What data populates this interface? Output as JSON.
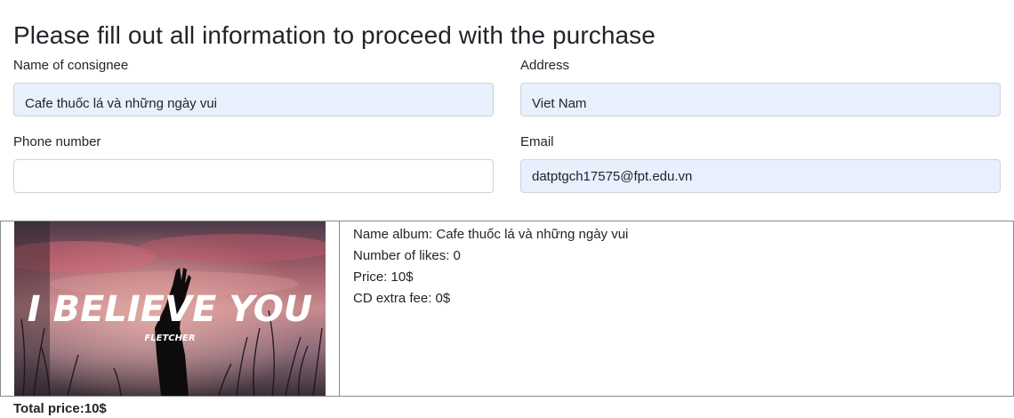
{
  "heading": "Please fill out all information to proceed with the purchase",
  "form": {
    "consignee": {
      "label": "Name of consignee",
      "value": "Cafe thuốc lá và những ngày vui"
    },
    "address": {
      "label": "Address",
      "value": "Viet Nam"
    },
    "phone": {
      "label": "Phone number",
      "value": ""
    },
    "email": {
      "label": "Email",
      "value": "datptgch17575@fpt.edu.vn"
    }
  },
  "album": {
    "cover_title": "I BELIEVE YOU",
    "cover_artist": "FLETCHER",
    "name_line": "Name album: Cafe thuốc lá và những ngày vui",
    "likes_line": "Number of likes: 0",
    "price_line": "Price: 10$",
    "cd_fee_line": "CD extra fee: 0$"
  },
  "total": "Total price:10$",
  "colors": {
    "autofill_bg": "#e8f0fe",
    "input_border": "#ced4da",
    "table_border": "#8a8a8a"
  }
}
